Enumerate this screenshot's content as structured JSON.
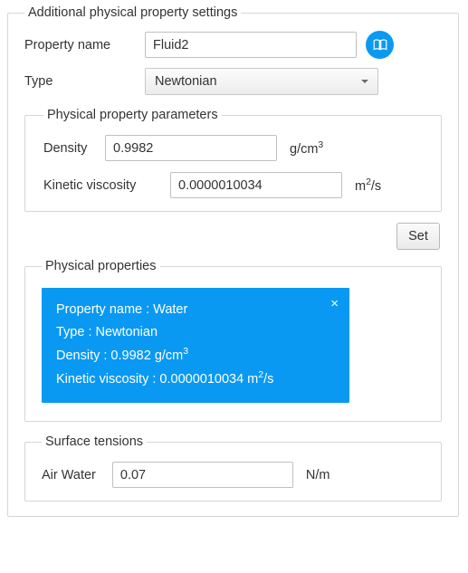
{
  "outer": {
    "legend": "Additional physical property settings"
  },
  "form": {
    "propertyNameLabel": "Property name",
    "propertyNameValue": "Fluid2",
    "typeLabel": "Type",
    "typeValue": "Newtonian"
  },
  "params": {
    "legend": "Physical property parameters",
    "densityLabel": "Density",
    "densityValue": "0.9982",
    "densityUnitBase": "g/cm",
    "densityUnitSup": "3",
    "viscosityLabel": "Kinetic viscosity",
    "viscosityValue": "0.0000010034",
    "viscosityUnitBase1": "m",
    "viscosityUnitSup": "2",
    "viscosityUnitBase2": "/s"
  },
  "setButton": "Set",
  "props": {
    "legend": "Physical properties",
    "card": {
      "line1": "Property name : Water",
      "line2": "Type : Newtonian",
      "line3pre": "Density : 0.9982 g/cm",
      "line3sup": "3",
      "line4pre": "Kinetic viscosity : 0.0000010034 m",
      "line4sup": "2",
      "line4post": "/s",
      "closeGlyph": "×"
    }
  },
  "surf": {
    "legend": "Surface tensions",
    "pairLabel": "Air  Water",
    "value": "0.07",
    "unit": "N/m"
  }
}
